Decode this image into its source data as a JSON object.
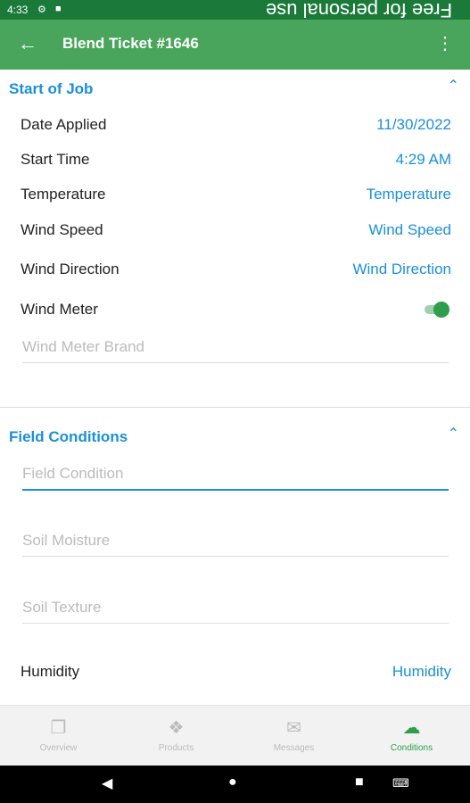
{
  "status_bar": {
    "time": "4:33",
    "watermark": "Free for personal use"
  },
  "app_bar": {
    "title": "Blend Ticket #1646"
  },
  "start_of_job": {
    "title": "Start of Job",
    "date_applied": {
      "label": "Date Applied",
      "value": "11/30/2022"
    },
    "start_time": {
      "label": "Start Time",
      "value": "4:29 AM"
    },
    "temperature": {
      "label": "Temperature",
      "value": "Temperature"
    },
    "wind_speed": {
      "label": "Wind Speed",
      "value": "Wind Speed"
    },
    "wind_direction": {
      "label": "Wind Direction",
      "value": "Wind Direction"
    },
    "wind_meter": {
      "label": "Wind Meter",
      "on": true
    },
    "wind_meter_brand": {
      "placeholder": "Wind Meter Brand"
    }
  },
  "field_conditions": {
    "title": "Field Conditions",
    "field_condition": {
      "placeholder": "Field Condition"
    },
    "soil_moisture": {
      "placeholder": "Soil Moisture"
    },
    "soil_texture": {
      "placeholder": "Soil Texture"
    },
    "humidity": {
      "label": "Humidity",
      "value": "Humidity"
    }
  },
  "tabs": [
    {
      "label": "Overview",
      "icon": "overview-icon"
    },
    {
      "label": "Products",
      "icon": "products-icon"
    },
    {
      "label": "Messages",
      "icon": "messages-icon"
    },
    {
      "label": "Conditions",
      "icon": "conditions-icon",
      "active": true
    }
  ],
  "colors": {
    "header": "#4aa55c",
    "status_bar": "#1b7a3a",
    "accent": "#1b8fd8",
    "active_tab": "#2e9e4a"
  }
}
